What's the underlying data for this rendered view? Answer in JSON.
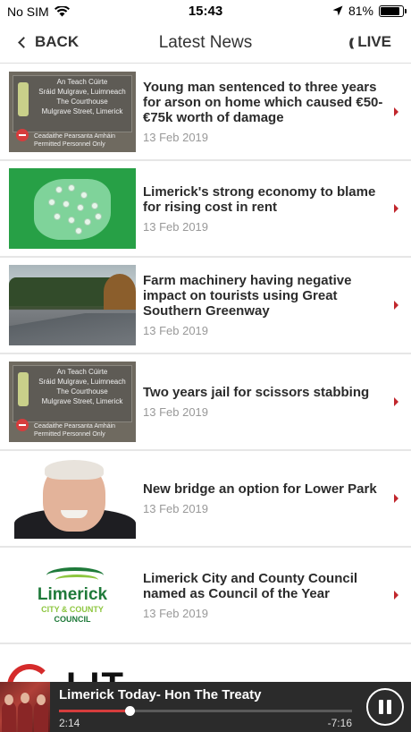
{
  "status_bar": {
    "carrier": "No SIM",
    "time": "15:43",
    "battery_text": "81%",
    "battery_level": 0.81
  },
  "nav": {
    "back_label": "BACK",
    "title": "Latest News",
    "live_label": "LIVE"
  },
  "news": [
    {
      "title": "Young man sentenced to three years for arson on home which caused €50-€75k worth of damage",
      "date": "13 Feb 2019",
      "thumb": "courthouse-sign",
      "sign_lines": [
        "An Teach Cúirte",
        "Sráid Mulgrave, Luimneach",
        "The Courthouse",
        "Mulgrave Street, Limerick"
      ],
      "sign_lower": [
        "Ceadaithe Pearsanta Amháin",
        "Permitted Personnel Only"
      ]
    },
    {
      "title": "Limerick's strong economy to blame for rising cost in rent",
      "date": "13 Feb 2019",
      "thumb": "ireland-map"
    },
    {
      "title": "Farm machinery having negative impact on tourists using Great Southern Greenway",
      "date": "13 Feb 2019",
      "thumb": "country-road"
    },
    {
      "title": "Two years jail for scissors stabbing",
      "date": "13 Feb 2019",
      "thumb": "courthouse-sign",
      "sign_lines": [
        "An Teach Cúirte",
        "Sráid Mulgrave, Luimneach",
        "The Courthouse",
        "Mulgrave Street, Limerick"
      ],
      "sign_lower": [
        "Ceadaithe Pearsanta Amháin",
        "Permitted Personnel Only"
      ]
    },
    {
      "title": "New bridge an option for Lower Park",
      "date": "13 Feb 2019",
      "thumb": "portrait"
    },
    {
      "title": "Limerick City and County Council named as Council of the Year",
      "date": "13 Feb 2019",
      "thumb": "council-logo",
      "logo_lines": [
        "Limerick",
        "CITY & COUNTY",
        "COUNCIL"
      ]
    }
  ],
  "partial_item": {
    "letters": "LIT"
  },
  "player": {
    "title": "Limerick Today- Hon The Treaty",
    "elapsed": "2:14",
    "remaining": "-7:16",
    "progress": 0.24,
    "accent_color": "#d63d3d"
  },
  "colors": {
    "arrow": "#c1272d",
    "player_bg": "#2b2b2b"
  }
}
